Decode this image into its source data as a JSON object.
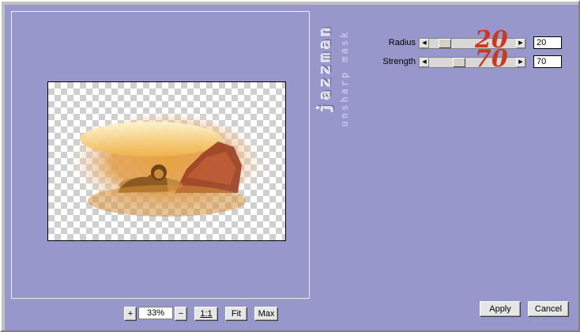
{
  "branding": {
    "main": "jazzman",
    "sub": "unsharp mask"
  },
  "params": [
    {
      "label": "Radius",
      "value": "20",
      "overlay": "20",
      "fraction": 0.2
    },
    {
      "label": "Strength",
      "value": "70",
      "overlay": "70",
      "fraction": 0.35
    }
  ],
  "zoom": {
    "plus": "+",
    "value": "33%",
    "minus": "−",
    "one_to_one": "1:1",
    "fit": "Fit",
    "max": "Max"
  },
  "actions": {
    "apply": "Apply",
    "cancel": "Cancel"
  },
  "colors": {
    "panel_bg": "#9797cb",
    "overlay_text": "#c83a1e"
  }
}
